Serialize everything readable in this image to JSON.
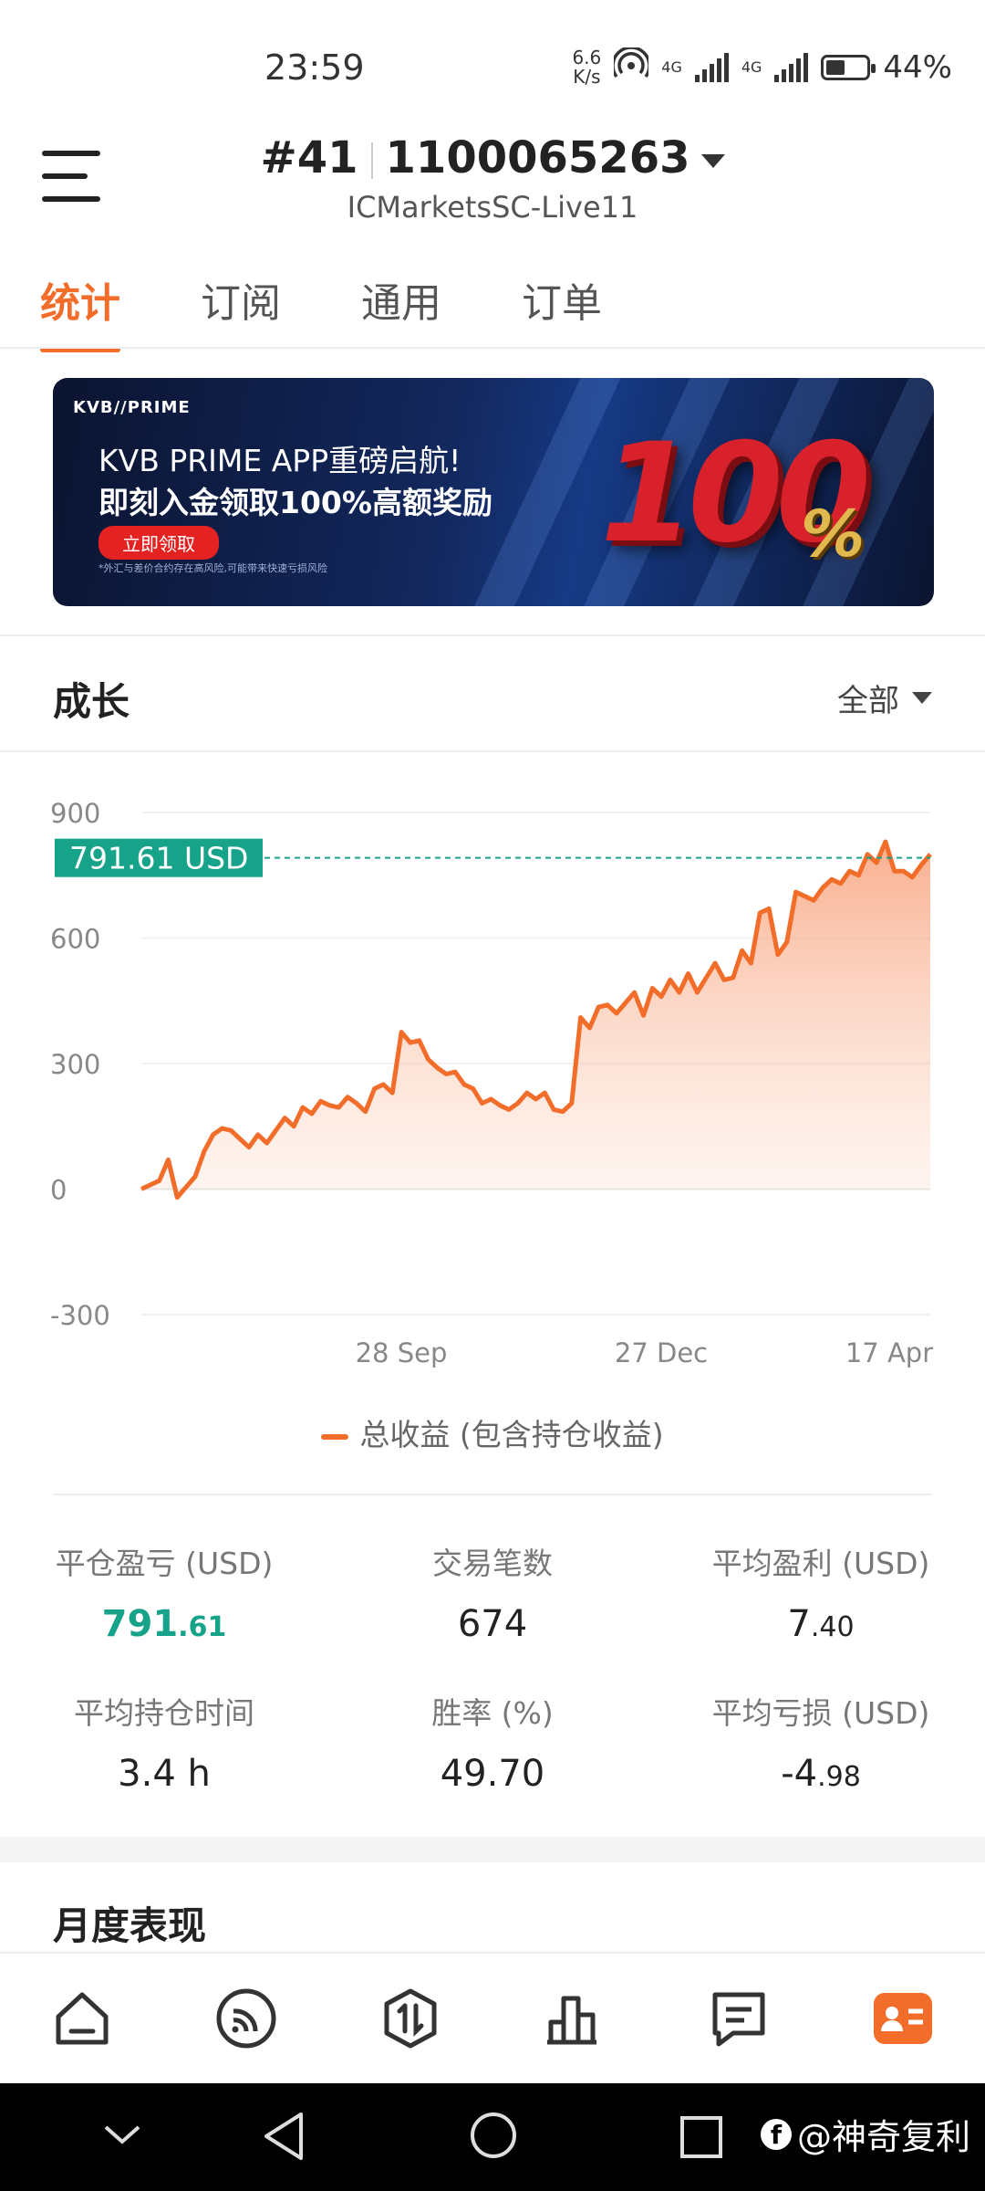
{
  "status_bar": {
    "time": "23:59",
    "net_speed_value": "6.6",
    "net_speed_unit": "K/s",
    "network_1": "4G",
    "network_2": "4G",
    "battery": "44%"
  },
  "header": {
    "account_index": "#41",
    "account_number": "1100065263",
    "server": "ICMarketsSC-Live11"
  },
  "tabs": [
    {
      "label": "统计",
      "active": true
    },
    {
      "label": "订阅",
      "active": false
    },
    {
      "label": "通用",
      "active": false
    },
    {
      "label": "订单",
      "active": false
    }
  ],
  "banner": {
    "brand": "KVB//PRIME",
    "line1": "KVB PRIME APP重磅启航!",
    "line2": "即刻入金领取100%高额奖励",
    "cta": "立即领取",
    "note": "*外汇与差价合约存在高风险,可能带来快速亏损风险",
    "big_number": "100",
    "percent": "%"
  },
  "growth": {
    "title": "成长",
    "period": "全部",
    "legend": "总收益 (包含持仓收益)"
  },
  "chart_data": {
    "type": "area",
    "y_ticks": [
      "900",
      "600",
      "300",
      "0",
      "-300"
    ],
    "ylim": [
      -300,
      900
    ],
    "x_ticks": [
      "28 Sep",
      "27 Dec",
      "17 Apr"
    ],
    "current_value_label": "791.61 USD",
    "current_value": 791.61,
    "series": [
      {
        "name": "总收益 (包含持仓收益)",
        "values": [
          0,
          10,
          20,
          70,
          -20,
          5,
          30,
          90,
          130,
          145,
          140,
          120,
          100,
          130,
          110,
          140,
          170,
          150,
          195,
          180,
          210,
          200,
          195,
          220,
          205,
          185,
          240,
          250,
          230,
          375,
          350,
          355,
          310,
          290,
          275,
          280,
          250,
          240,
          205,
          215,
          200,
          190,
          205,
          230,
          215,
          230,
          190,
          185,
          205,
          410,
          385,
          435,
          440,
          420,
          445,
          470,
          415,
          480,
          460,
          500,
          470,
          515,
          470,
          505,
          540,
          500,
          505,
          570,
          540,
          660,
          670,
          560,
          590,
          710,
          700,
          690,
          720,
          740,
          730,
          760,
          750,
          800,
          780,
          830,
          760,
          760,
          745,
          775,
          800
        ],
        "color": "#f36d2a"
      }
    ]
  },
  "stats": [
    {
      "label": "平仓盈亏 (USD)",
      "value_main": "791",
      "value_dec": ".61",
      "highlight": true
    },
    {
      "label": "交易笔数",
      "value_main": "674",
      "value_dec": "",
      "highlight": false
    },
    {
      "label": "平均盈利 (USD)",
      "value_main": "7",
      "value_dec": ".40",
      "highlight": false
    },
    {
      "label": "平均持仓时间",
      "value_main": "3.4 h",
      "value_dec": "",
      "highlight": false
    },
    {
      "label": "胜率 (%)",
      "value_main": "49.70",
      "value_dec": "",
      "highlight": false
    },
    {
      "label": "平均亏损 (USD)",
      "value_main": "-4",
      "value_dec": ".98",
      "highlight": false
    }
  ],
  "monthly": {
    "title": "月度表现"
  },
  "bottom_nav": [
    "home-icon",
    "feed-icon",
    "trade-icon",
    "chart-icon",
    "message-icon",
    "profile-card-icon"
  ],
  "watermark": "@神奇复利",
  "colors": {
    "accent": "#f36d2a",
    "green": "#16a389"
  }
}
